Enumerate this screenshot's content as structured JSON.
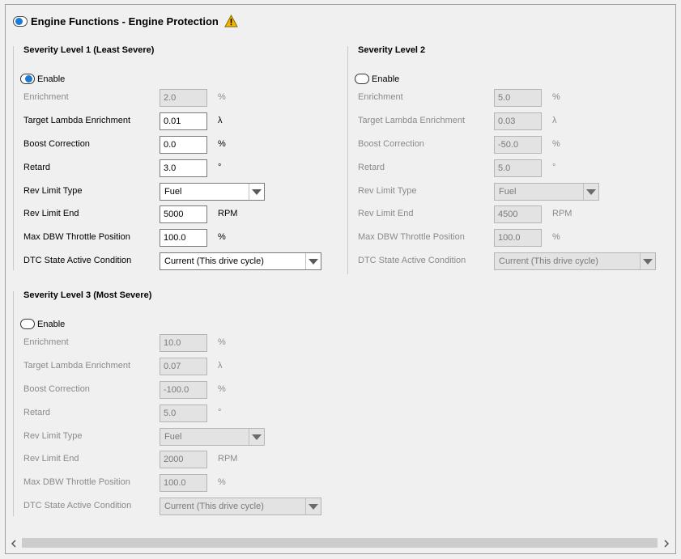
{
  "header": {
    "title": "Engine Functions - Engine Protection",
    "icon": "warning-icon",
    "warning_color": "#f2b600"
  },
  "colors": {
    "accent": "#1b7ad6"
  },
  "levels": [
    {
      "title": "Severity Level 1 (Least Severe)",
      "enable_label": "Enable",
      "enabled": true,
      "enrichment": {
        "label": "Enrichment",
        "value": "2.0",
        "unit": "%"
      },
      "target_lambda": {
        "label": "Target Lambda Enrichment",
        "value": "0.01",
        "unit": "λ"
      },
      "boost": {
        "label": "Boost Correction",
        "value": "0.0",
        "unit": "%"
      },
      "retard": {
        "label": "Retard",
        "value": "3.0",
        "unit": "°"
      },
      "rev_limit_type": {
        "label": "Rev Limit Type",
        "value": "Fuel"
      },
      "rev_limit_end": {
        "label": "Rev Limit End",
        "value": "5000",
        "unit": "RPM"
      },
      "max_dbw": {
        "label": "Max DBW Throttle Position",
        "value": "100.0",
        "unit": "%"
      },
      "dtc_state": {
        "label": "DTC State Active Condition",
        "value": "Current (This drive cycle)"
      }
    },
    {
      "title": "Severity Level 2",
      "enable_label": "Enable",
      "enabled": false,
      "enrichment": {
        "label": "Enrichment",
        "value": "5.0",
        "unit": "%"
      },
      "target_lambda": {
        "label": "Target Lambda Enrichment",
        "value": "0.03",
        "unit": "λ"
      },
      "boost": {
        "label": "Boost Correction",
        "value": "-50.0",
        "unit": "%"
      },
      "retard": {
        "label": "Retard",
        "value": "5.0",
        "unit": "°"
      },
      "rev_limit_type": {
        "label": "Rev Limit Type",
        "value": "Fuel"
      },
      "rev_limit_end": {
        "label": "Rev Limit End",
        "value": "4500",
        "unit": "RPM"
      },
      "max_dbw": {
        "label": "Max DBW Throttle Position",
        "value": "100.0",
        "unit": "%"
      },
      "dtc_state": {
        "label": "DTC State Active Condition",
        "value": "Current (This drive cycle)"
      }
    },
    {
      "title": "Severity Level 3 (Most Severe)",
      "enable_label": "Enable",
      "enabled": false,
      "enrichment": {
        "label": "Enrichment",
        "value": "10.0",
        "unit": "%"
      },
      "target_lambda": {
        "label": "Target Lambda Enrichment",
        "value": "0.07",
        "unit": "λ"
      },
      "boost": {
        "label": "Boost Correction",
        "value": "-100.0",
        "unit": "%"
      },
      "retard": {
        "label": "Retard",
        "value": "5.0",
        "unit": "°"
      },
      "rev_limit_type": {
        "label": "Rev Limit Type",
        "value": "Fuel"
      },
      "rev_limit_end": {
        "label": "Rev Limit End",
        "value": "2000",
        "unit": "RPM"
      },
      "max_dbw": {
        "label": "Max DBW Throttle Position",
        "value": "100.0",
        "unit": "%"
      },
      "dtc_state": {
        "label": "DTC State Active Condition",
        "value": "Current (This drive cycle)"
      }
    }
  ],
  "scrollbar": {
    "left_icon": "chevron-left-icon",
    "right_icon": "chevron-right-icon"
  }
}
